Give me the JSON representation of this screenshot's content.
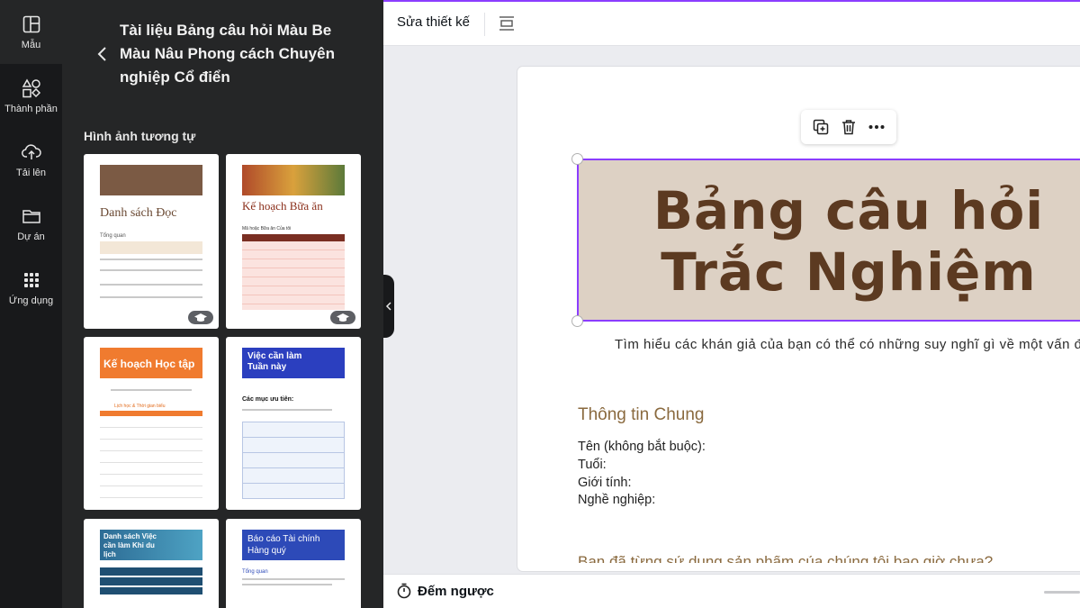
{
  "rail": {
    "items": [
      {
        "label": "Mẫu",
        "icon": "template-icon"
      },
      {
        "label": "Thành phần",
        "icon": "elements-icon"
      },
      {
        "label": "Tải lên",
        "icon": "upload-icon"
      },
      {
        "label": "Dự án",
        "icon": "folder-icon"
      },
      {
        "label": "Ứng dụng",
        "icon": "apps-grid-icon"
      }
    ]
  },
  "panel": {
    "title": "Tài liệu Bảng câu hỏi Màu Be Màu Nâu Phong cách Chuyên nghiệp Cổ điển",
    "section_heading": "Hình ảnh tương tự",
    "templates": [
      {
        "title": "Danh sách Đọc",
        "sub": "Tổng quan",
        "premium": true
      },
      {
        "title": "Kế hoạch Bữa ăn",
        "sub": "Mã hoặc Bữa ăn Của tôi",
        "premium": true
      },
      {
        "title": "Kế hoạch Học tập",
        "sub": "Lịch học & Thời gian biểu",
        "premium": false
      },
      {
        "title": "Việc cần làm Tuần này",
        "sub": "Các mục ưu tiên:",
        "premium": false
      },
      {
        "title": "Danh sách Việc cần làm Khi du lịch",
        "sub": "",
        "premium": false
      },
      {
        "title": "Báo cáo Tài chính Hàng quý",
        "sub": "Tổng quan",
        "premium": false
      }
    ]
  },
  "topbar": {
    "edit_design": "Sửa thiết kế"
  },
  "document": {
    "title_line1": "Bảng câu hỏi",
    "title_line2": "Trắc Nghiệm",
    "subtitle": "Tìm hiểu các khán giả của bạn có thể có những suy nghĩ gì về một vấn đề",
    "section_title": "Thông tin Chung",
    "fields": [
      "Tên (không bắt buộc):",
      "Tuổi:",
      "Giới tính:",
      "Nghề nghiệp:"
    ],
    "cut_text": "Bạn đã từng sử dụng sản phẩm của chúng tôi bao giờ chưa?"
  },
  "bottombar": {
    "timer_label": "Đếm ngược"
  },
  "colors": {
    "accent": "#8b3dff",
    "title_bg": "#ddd1c4",
    "title_text": "#5c3a21",
    "section_text": "#8a6a3f",
    "dark_panel": "#252627"
  }
}
